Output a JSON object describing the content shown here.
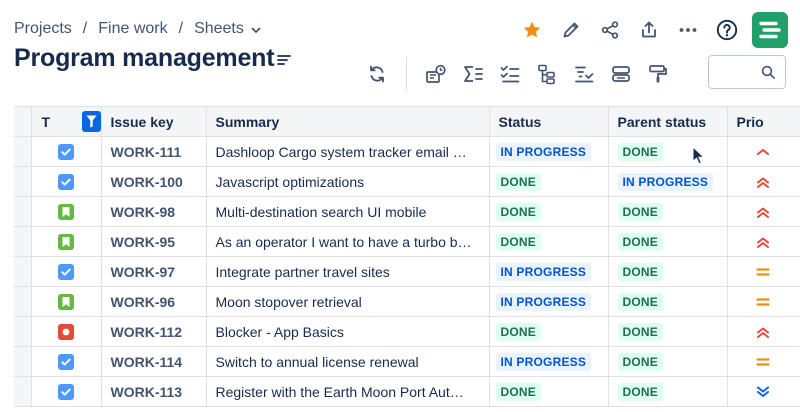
{
  "breadcrumb": {
    "items": [
      "Projects",
      "Fine work",
      "Sheets"
    ],
    "separator": "/"
  },
  "page": {
    "title": "Program management"
  },
  "colors": {
    "star": "#f18d13",
    "logo_bg": "#22a06b",
    "done_bg": "#dcfff1",
    "done_text": "#216e4e",
    "progress_bg": "#e9f2ff",
    "progress_text": "#0055cc",
    "filter_active": "#0c66e4"
  },
  "header_icons": [
    "star-icon",
    "edit-pencil-icon",
    "share-icon",
    "export-icon",
    "more-icon",
    "help-icon",
    "app-logo-icon"
  ],
  "toolbar_icons": [
    "refresh-icon",
    "chart-icon",
    "sum-icon",
    "checklist-icon",
    "hierarchy-icon",
    "filter-list-icon",
    "group-icon",
    "format-painter-icon"
  ],
  "search": {
    "placeholder": "",
    "value": ""
  },
  "table": {
    "columns": {
      "type": "T",
      "key": "Issue key",
      "summary": "Summary",
      "status": "Status",
      "parent_status": "Parent status",
      "priority": "Prio"
    },
    "rows": [
      {
        "type": "task",
        "key": "WORK-111",
        "summary": "Dashloop Cargo system tracker email …",
        "status": "IN PROGRESS",
        "parent_status": "DONE",
        "priority": "low-chevron"
      },
      {
        "type": "task",
        "key": "WORK-100",
        "summary": "Javascript optimizations",
        "status": "DONE",
        "parent_status": "IN PROGRESS",
        "priority": "high"
      },
      {
        "type": "story",
        "key": "WORK-98",
        "summary": "Multi-destination search UI mobile",
        "status": "DONE",
        "parent_status": "DONE",
        "priority": "high"
      },
      {
        "type": "story",
        "key": "WORK-95",
        "summary": "As an operator I want to have a turbo b…",
        "status": "DONE",
        "parent_status": "DONE",
        "priority": "high"
      },
      {
        "type": "task",
        "key": "WORK-97",
        "summary": "Integrate partner travel sites",
        "status": "IN PROGRESS",
        "parent_status": "DONE",
        "priority": "medium"
      },
      {
        "type": "story",
        "key": "WORK-96",
        "summary": "Moon stopover retrieval",
        "status": "IN PROGRESS",
        "parent_status": "DONE",
        "priority": "medium"
      },
      {
        "type": "bug",
        "key": "WORK-112",
        "summary": "Blocker - App Basics",
        "status": "DONE",
        "parent_status": "DONE",
        "priority": "high"
      },
      {
        "type": "task",
        "key": "WORK-114",
        "summary": "Switch to annual license renewal",
        "status": "IN PROGRESS",
        "parent_status": "DONE",
        "priority": "medium"
      },
      {
        "type": "task",
        "key": "WORK-113",
        "summary": "Register with the Earth Moon Port Aut…",
        "status": "DONE",
        "parent_status": "DONE",
        "priority": "lowest"
      }
    ]
  }
}
